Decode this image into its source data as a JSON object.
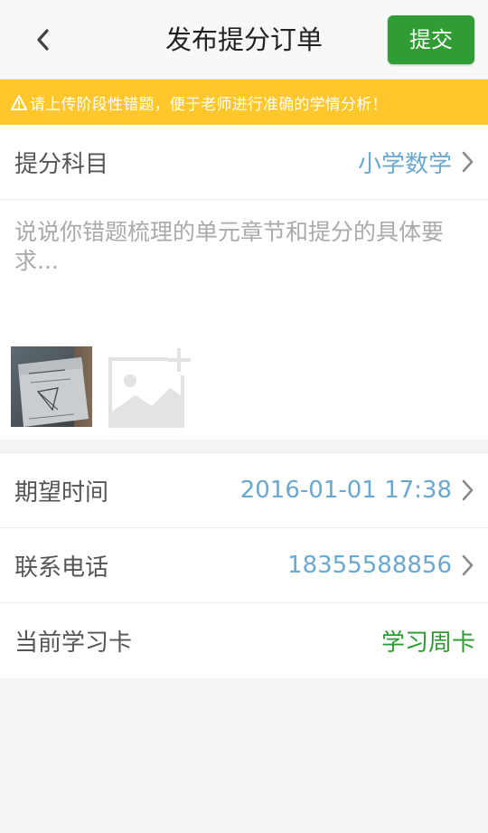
{
  "header": {
    "title": "发布提分订单",
    "submit_label": "提交"
  },
  "notice": {
    "text": "请上传阶段性错题，便于老师进行准确的学情分析！"
  },
  "subject": {
    "label": "提分科目",
    "value": "小学数学"
  },
  "description": {
    "placeholder": "说说你错题梳理的单元章节和提分的具体要求...",
    "value": ""
  },
  "schedule": {
    "time_label": "期望时间",
    "time_value": "2016-01-01 17:38",
    "phone_label": "联系电话",
    "phone_value": "18355588856",
    "card_label": "当前学习卡",
    "card_value": "学习周卡"
  },
  "colors": {
    "accent_green": "#2f9d33",
    "notice_yellow": "#ffc72c",
    "value_blue": "#6aa8cf",
    "card_green": "#2e9a33"
  },
  "icons": {
    "back": "chevron-left-icon",
    "row_arrow": "chevron-right-icon",
    "warning": "warning-icon",
    "add_photo": "add-image-icon"
  }
}
